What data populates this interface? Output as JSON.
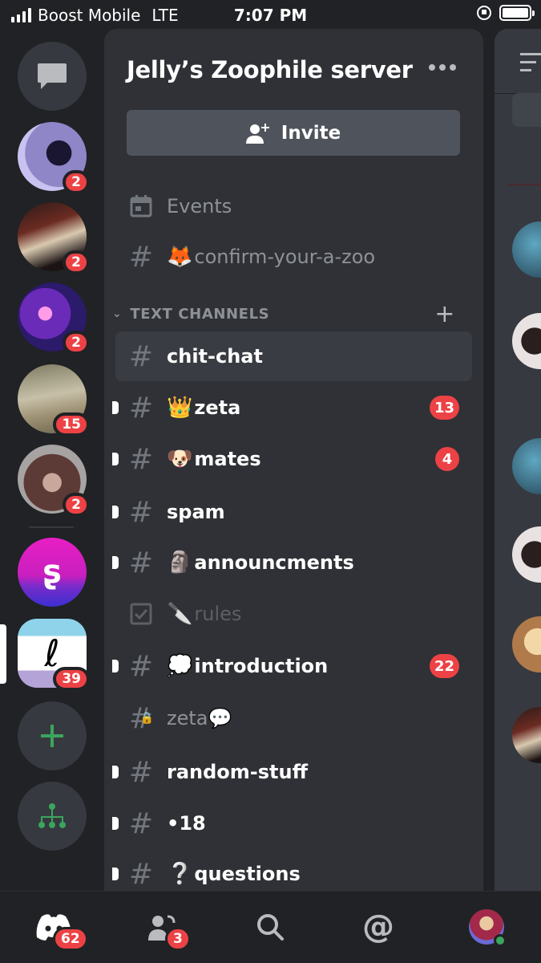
{
  "status_bar": {
    "carrier": "Boost Mobile",
    "network": "LTE",
    "time": "7:07 PM"
  },
  "rail": {
    "servers": [
      {
        "icon": "dm-chat-icon"
      },
      {
        "badge": "2",
        "color": "#8f86c8"
      },
      {
        "badge": "2",
        "color": "#6b2b22"
      },
      {
        "badge": "2",
        "color": "#6a2bb8"
      },
      {
        "badge": "15",
        "color": "#9c8f72"
      },
      {
        "badge": "2",
        "color": "#5c3a35"
      },
      {
        "color": "#c91fbf"
      },
      {
        "badge": "39",
        "color": "#b4a3d6"
      }
    ]
  },
  "panel": {
    "server_name": "Jelly’s Zoophile server",
    "invite_label": "Invite",
    "top_rows": [
      {
        "icon": "calendar-icon",
        "label": "Events"
      },
      {
        "icon": "hash-icon",
        "emoji": "🦊",
        "label": "confirm-your-a-zoo"
      }
    ],
    "category": "TEXT CHANNELS",
    "channels": [
      {
        "label": "chit-chat",
        "active": true
      },
      {
        "emoji": "👑",
        "label": "zeta",
        "badge": "13",
        "unread": true
      },
      {
        "emoji": "🐶",
        "label": "mates",
        "badge": "4",
        "unread": true
      },
      {
        "label": "spam",
        "unread": true
      },
      {
        "emoji": "🗿",
        "label": "announcments",
        "unread": true
      },
      {
        "emoji": "🔪",
        "label": "rules",
        "muted": true,
        "icon": "rules-checkbox-icon"
      },
      {
        "emoji": "💭",
        "label": "introduction",
        "badge": "22",
        "unread": true
      },
      {
        "label": "zeta💬",
        "locked": true
      },
      {
        "label": "random-stuff",
        "unread": true
      },
      {
        "label": "•18",
        "unread": true
      },
      {
        "emoji": "❔",
        "label": "questions",
        "unread": true
      }
    ]
  },
  "tabbar": {
    "home_badge": "62",
    "friends_badge": "3"
  }
}
